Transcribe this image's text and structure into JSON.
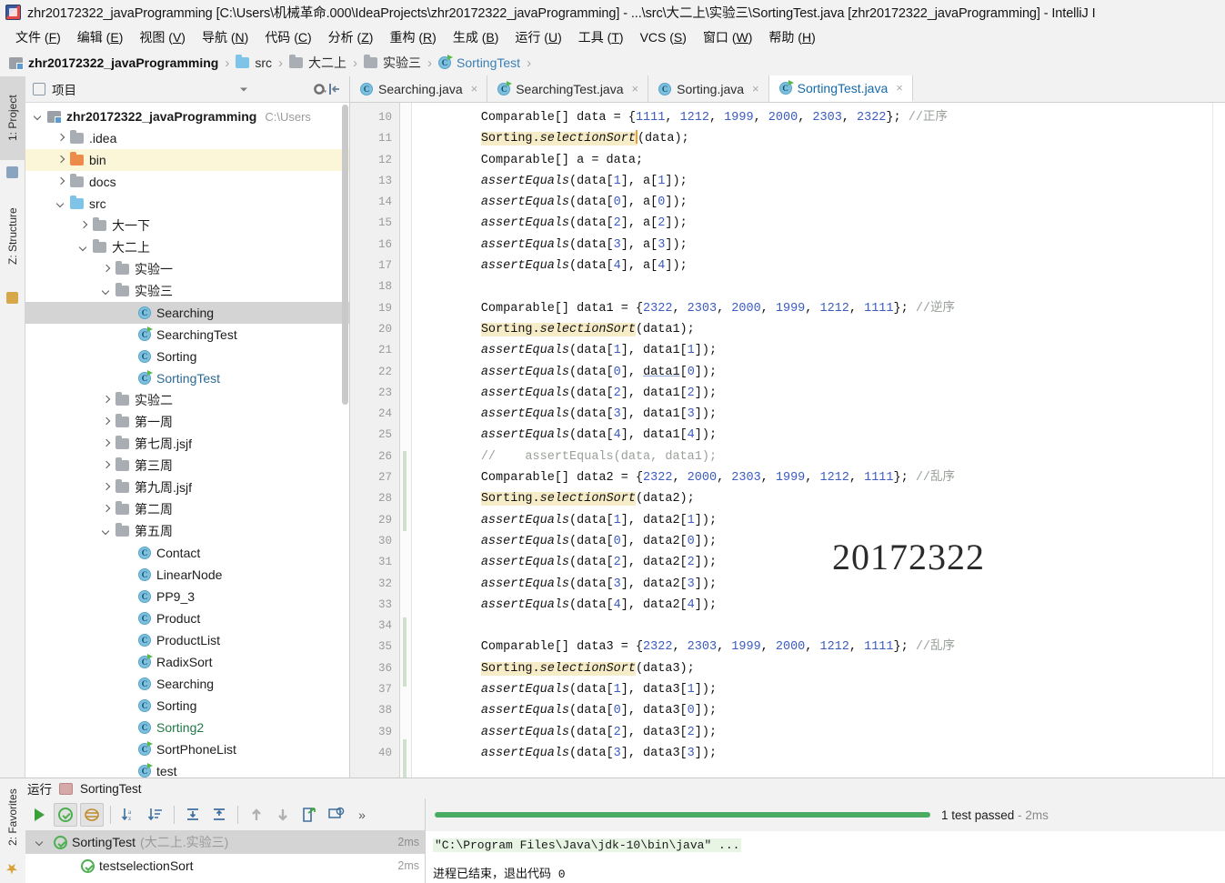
{
  "window": {
    "title": "zhr20172322_javaProgramming [C:\\Users\\机械革命.000\\IdeaProjects\\zhr20172322_javaProgramming] - ...\\src\\大二上\\实验三\\SortingTest.java [zhr20172322_javaProgramming] - IntelliJ I",
    "app_icon": "intellij-idea-icon"
  },
  "menu": [
    {
      "label": "文件",
      "mnemonic": "F"
    },
    {
      "label": "编辑",
      "mnemonic": "E"
    },
    {
      "label": "视图",
      "mnemonic": "V"
    },
    {
      "label": "导航",
      "mnemonic": "N"
    },
    {
      "label": "代码",
      "mnemonic": "C"
    },
    {
      "label": "分析",
      "mnemonic": "Z"
    },
    {
      "label": "重构",
      "mnemonic": "R"
    },
    {
      "label": "生成",
      "mnemonic": "B"
    },
    {
      "label": "运行",
      "mnemonic": "U"
    },
    {
      "label": "工具",
      "mnemonic": "T"
    },
    {
      "label": "VCS",
      "mnemonic": "S"
    },
    {
      "label": "窗口",
      "mnemonic": "W"
    },
    {
      "label": "帮助",
      "mnemonic": "H"
    }
  ],
  "breadcrumb": [
    {
      "label": "zhr20172322_javaProgramming",
      "icon": "module-icon",
      "style": "first"
    },
    {
      "label": "src",
      "icon": "folder-blue-icon",
      "style": "normal"
    },
    {
      "label": "大二上",
      "icon": "folder-icon",
      "style": "normal"
    },
    {
      "label": "实验三",
      "icon": "folder-icon",
      "style": "normal"
    },
    {
      "label": "SortingTest",
      "icon": "class-test-icon",
      "style": "accent"
    }
  ],
  "left_rail": [
    {
      "label": "1: Project",
      "mnemonic": "P",
      "icon": "project-icon",
      "selected": true
    },
    {
      "label": "Z: Structure",
      "mnemonic": "Z",
      "icon": "structure-icon",
      "selected": false
    }
  ],
  "bottom_rail": [
    {
      "label": "2: Favorites",
      "mnemonic": "F",
      "icon": "star-icon"
    }
  ],
  "project_panel": {
    "title": "项目",
    "dropdown_icon": "chevron-down-icon",
    "settings_icon": "gear-icon",
    "collapse_icon": "collapse-all-icon",
    "tree": [
      {
        "label": "zhr20172322_javaProgramming",
        "suffix": "C:\\Users",
        "icon": "module-icon",
        "arrow": "down",
        "indent": 0,
        "style": "bold"
      },
      {
        "label": ".idea",
        "icon": "folder-icon",
        "arrow": "right",
        "indent": 1,
        "style": "normal"
      },
      {
        "label": "bin",
        "icon": "folder-orange-icon",
        "arrow": "right",
        "indent": 1,
        "style": "normal",
        "highlight": true
      },
      {
        "label": "docs",
        "icon": "folder-icon",
        "arrow": "right",
        "indent": 1,
        "style": "normal"
      },
      {
        "label": "src",
        "icon": "folder-blue-icon",
        "arrow": "down",
        "indent": 1,
        "style": "normal"
      },
      {
        "label": "大一下",
        "icon": "folder-icon",
        "arrow": "right",
        "indent": 2,
        "style": "normal"
      },
      {
        "label": "大二上",
        "icon": "folder-icon",
        "arrow": "down",
        "indent": 2,
        "style": "normal"
      },
      {
        "label": "实验一",
        "icon": "folder-icon",
        "arrow": "right",
        "indent": 3,
        "style": "normal"
      },
      {
        "label": "实验三",
        "icon": "folder-icon",
        "arrow": "down",
        "indent": 3,
        "style": "normal"
      },
      {
        "label": "Searching",
        "icon": "class-icon",
        "arrow": "none",
        "indent": 4,
        "style": "normal",
        "selected": true
      },
      {
        "label": "SearchingTest",
        "icon": "class-test-icon",
        "arrow": "none",
        "indent": 4,
        "style": "normal"
      },
      {
        "label": "Sorting",
        "icon": "class-icon",
        "arrow": "none",
        "indent": 4,
        "style": "normal"
      },
      {
        "label": "SortingTest",
        "icon": "class-test-icon",
        "arrow": "none",
        "indent": 4,
        "style": "blueish"
      },
      {
        "label": "实验二",
        "icon": "folder-icon",
        "arrow": "right",
        "indent": 3,
        "style": "normal"
      },
      {
        "label": "第一周",
        "icon": "folder-icon",
        "arrow": "right",
        "indent": 3,
        "style": "normal"
      },
      {
        "label": "第七周.jsjf",
        "icon": "folder-icon",
        "arrow": "right",
        "indent": 3,
        "style": "normal"
      },
      {
        "label": "第三周",
        "icon": "folder-icon",
        "arrow": "right",
        "indent": 3,
        "style": "normal"
      },
      {
        "label": "第九周.jsjf",
        "icon": "folder-icon",
        "arrow": "right",
        "indent": 3,
        "style": "normal"
      },
      {
        "label": "第二周",
        "icon": "folder-icon",
        "arrow": "right",
        "indent": 3,
        "style": "normal"
      },
      {
        "label": "第五周",
        "icon": "folder-icon",
        "arrow": "down",
        "indent": 3,
        "style": "normal"
      },
      {
        "label": "Contact",
        "icon": "class-icon",
        "arrow": "none",
        "indent": 4,
        "style": "normal"
      },
      {
        "label": "LinearNode",
        "icon": "class-icon",
        "arrow": "none",
        "indent": 4,
        "style": "normal"
      },
      {
        "label": "PP9_3",
        "icon": "class-icon",
        "arrow": "none",
        "indent": 4,
        "style": "normal"
      },
      {
        "label": "Product",
        "icon": "class-icon",
        "arrow": "none",
        "indent": 4,
        "style": "normal"
      },
      {
        "label": "ProductList",
        "icon": "class-icon",
        "arrow": "none",
        "indent": 4,
        "style": "normal"
      },
      {
        "label": "RadixSort",
        "icon": "class-test-icon",
        "arrow": "none",
        "indent": 4,
        "style": "normal"
      },
      {
        "label": "Searching",
        "icon": "class-icon",
        "arrow": "none",
        "indent": 4,
        "style": "normal"
      },
      {
        "label": "Sorting",
        "icon": "class-icon",
        "arrow": "none",
        "indent": 4,
        "style": "normal"
      },
      {
        "label": "Sorting2",
        "icon": "class-icon",
        "arrow": "none",
        "indent": 4,
        "style": "green"
      },
      {
        "label": "SortPhoneList",
        "icon": "class-test-icon",
        "arrow": "none",
        "indent": 4,
        "style": "normal"
      },
      {
        "label": "test",
        "icon": "class-test-icon",
        "arrow": "none",
        "indent": 4,
        "style": "normal"
      }
    ]
  },
  "editor": {
    "tabs": [
      {
        "label": "Searching.java",
        "icon": "class-icon",
        "active": false,
        "close": "×"
      },
      {
        "label": "SearchingTest.java",
        "icon": "class-test-icon",
        "active": false,
        "close": "×"
      },
      {
        "label": "Sorting.java",
        "icon": "class-icon",
        "active": false,
        "close": "×"
      },
      {
        "label": "SortingTest.java",
        "icon": "class-test-icon",
        "active": true,
        "close": "×"
      }
    ],
    "first_line_number": 10,
    "line_numbers": [
      10,
      11,
      12,
      13,
      14,
      15,
      16,
      17,
      18,
      19,
      20,
      21,
      22,
      23,
      24,
      25,
      26,
      27,
      28,
      29,
      30,
      31,
      32,
      33,
      34,
      35,
      36,
      37,
      38,
      39,
      40
    ],
    "watermark": "20172322",
    "lines": [
      {
        "n": 10,
        "text": "Comparable[] data = {1111, 1212, 1999, 2000, 2303, 2322}; //正序"
      },
      {
        "n": 11,
        "text": "Sorting.selectionSort(data);"
      },
      {
        "n": 12,
        "text": "Comparable[] a = data;"
      },
      {
        "n": 13,
        "text": "assertEquals(data[1], a[1]);"
      },
      {
        "n": 14,
        "text": "assertEquals(data[0], a[0]);"
      },
      {
        "n": 15,
        "text": "assertEquals(data[2], a[2]);"
      },
      {
        "n": 16,
        "text": "assertEquals(data[3], a[3]);"
      },
      {
        "n": 17,
        "text": "assertEquals(data[4], a[4]);"
      },
      {
        "n": 18,
        "text": ""
      },
      {
        "n": 19,
        "text": "Comparable[] data1 = {2322, 2303, 2000, 1999, 1212, 1111}; //逆序"
      },
      {
        "n": 20,
        "text": "Sorting.selectionSort(data1);"
      },
      {
        "n": 21,
        "text": "assertEquals(data[1], data1[1]);"
      },
      {
        "n": 22,
        "text": "assertEquals(data[0], data1[0]);"
      },
      {
        "n": 23,
        "text": "assertEquals(data[2], data1[2]);"
      },
      {
        "n": 24,
        "text": "assertEquals(data[3], data1[3]);"
      },
      {
        "n": 25,
        "text": "assertEquals(data[4], data1[4]);"
      },
      {
        "n": 26,
        "text": "//    assertEquals(data, data1);"
      },
      {
        "n": 27,
        "text": "Comparable[] data2 = {2322, 2000, 2303, 1999, 1212, 1111}; //乱序"
      },
      {
        "n": 28,
        "text": "Sorting.selectionSort(data2);"
      },
      {
        "n": 29,
        "text": "assertEquals(data[1], data2[1]);"
      },
      {
        "n": 30,
        "text": "assertEquals(data[0], data2[0]);"
      },
      {
        "n": 31,
        "text": "assertEquals(data[2], data2[2]);"
      },
      {
        "n": 32,
        "text": "assertEquals(data[3], data2[3]);"
      },
      {
        "n": 33,
        "text": "assertEquals(data[4], data2[4]);"
      },
      {
        "n": 34,
        "text": ""
      },
      {
        "n": 35,
        "text": "Comparable[] data3 = {2322, 2303, 1999, 2000, 1212, 1111}; //乱序"
      },
      {
        "n": 36,
        "text": "Sorting.selectionSort(data3);"
      },
      {
        "n": 37,
        "text": "assertEquals(data[1], data3[1]);"
      },
      {
        "n": 38,
        "text": "assertEquals(data[0], data3[0]);"
      },
      {
        "n": 39,
        "text": "assertEquals(data[2], data3[2]);"
      },
      {
        "n": 40,
        "text": "assertEquals(data[3], data3[3]);"
      }
    ]
  },
  "run_panel": {
    "title": "运行",
    "config_name": "SortingTest",
    "toolbar": [
      {
        "name": "rerun-icon",
        "glyph": "▶"
      },
      {
        "name": "toggle-passed-tests-icon",
        "glyph": "✓",
        "active": true
      },
      {
        "name": "hide-ignored-icon",
        "glyph": "≡",
        "active": true
      },
      {
        "name": "sort-alphabetically-icon",
        "glyph": "↓a"
      },
      {
        "name": "sort-by-duration-icon",
        "glyph": "↓≡"
      },
      {
        "name": "expand-all-icon",
        "glyph": "⤓"
      },
      {
        "name": "collapse-all-icon",
        "glyph": "⤒"
      },
      {
        "name": "prev-failed-icon",
        "glyph": "↑"
      },
      {
        "name": "next-failed-icon",
        "glyph": "↓"
      },
      {
        "name": "export-results-icon",
        "glyph": "⤴"
      },
      {
        "name": "test-history-icon",
        "glyph": "⟳"
      },
      {
        "name": "more-options-icon",
        "glyph": "»"
      }
    ],
    "tests": [
      {
        "name": "SortingTest",
        "location": "(大二上.实验三)",
        "duration": "2ms",
        "status": "passed",
        "level": 0,
        "selected": true,
        "arrow": "down"
      },
      {
        "name": "testselectionSort",
        "location": "",
        "duration": "2ms",
        "status": "passed",
        "level": 1,
        "selected": false,
        "arrow": "none"
      }
    ],
    "status_text": "1 test passed",
    "status_duration": "- 2ms",
    "progress_color": "#4aab63",
    "console": {
      "command": "\"C:\\Program Files\\Java\\jdk-10\\bin\\java\" ...",
      "output": "进程已结束，退出代码 0"
    }
  }
}
